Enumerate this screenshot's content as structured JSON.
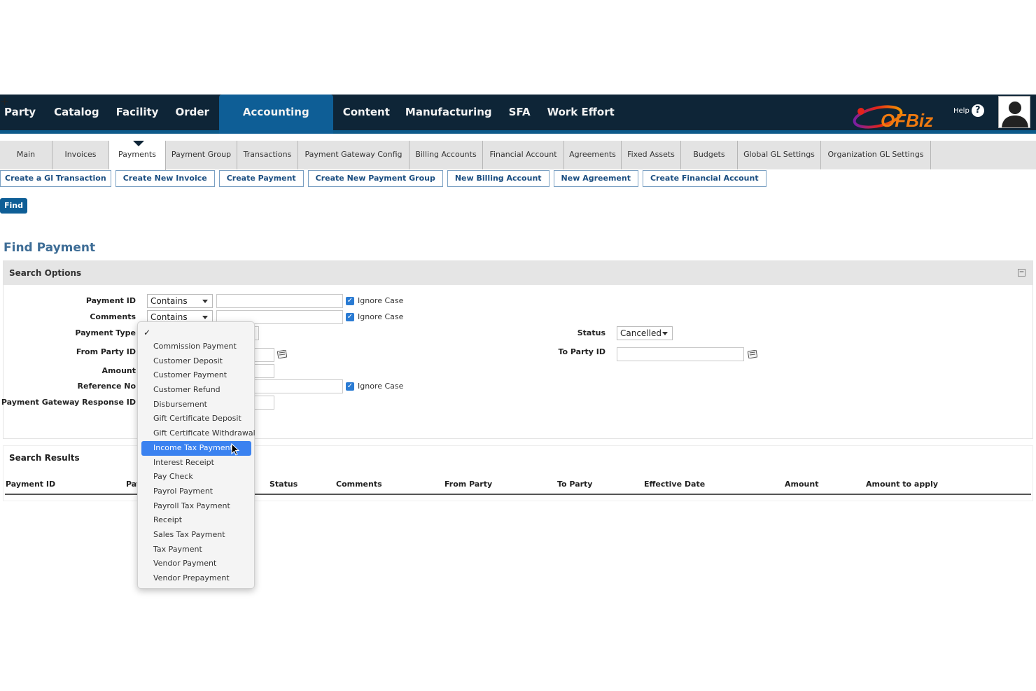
{
  "topnav": {
    "items": [
      "Party",
      "Catalog",
      "Facility",
      "Order",
      "Accounting",
      "Content",
      "Manufacturing",
      "SFA",
      "Work Effort"
    ],
    "active": "Accounting",
    "plus": "+",
    "logo_text": "OFBiz",
    "help_label": "Help",
    "help_glyph": "?"
  },
  "subtabs": {
    "items": [
      "Main",
      "Invoices",
      "Payments",
      "Payment Group",
      "Transactions",
      "Payment Gateway Config",
      "Billing Accounts",
      "Financial Account",
      "Agreements",
      "Fixed Assets",
      "Budgets",
      "Global GL Settings",
      "Organization GL Settings"
    ],
    "active": "Payments"
  },
  "actions": [
    "Create a Gl Transaction",
    "Create New Invoice",
    "Create Payment",
    "Create New Payment Group",
    "New Billing Account",
    "New Agreement",
    "Create Financial Account"
  ],
  "find_button": "Find",
  "page_title": "Find Payment",
  "search_options": {
    "title": "Search Options",
    "collapse_glyph": "−",
    "labels": {
      "payment_id": "Payment ID",
      "comments": "Comments",
      "payment_type": "Payment Type",
      "from_party": "From Party ID",
      "amount": "Amount",
      "reference_no": "Reference No",
      "gateway_response": "Payment Gateway Response ID",
      "status": "Status",
      "to_party": "To Party ID"
    },
    "payment_id_op": "Contains",
    "comments_op": "Contains",
    "ignore_case": "Ignore Case",
    "status_value": "Cancelled"
  },
  "search_results": {
    "title": "Search Results",
    "columns": [
      "Payment ID",
      "Pay",
      "Status",
      "Comments",
      "From Party",
      "To Party",
      "Effective Date",
      "Amount",
      "Amount to apply"
    ]
  },
  "payment_type_dropdown": {
    "check": "✓",
    "options": [
      "Commission Payment",
      "Customer Deposit",
      "Customer Payment",
      "Customer Refund",
      "Disbursement",
      "Gift Certificate Deposit",
      "Gift Certificate Withdrawal",
      "Income Tax Payment",
      "Interest Receipt",
      "Pay Check",
      "Payrol Payment",
      "Payroll Tax Payment",
      "Receipt",
      "Sales Tax Payment",
      "Tax Payment",
      "Vendor Payment",
      "Vendor Prepayment"
    ],
    "highlighted": "Income Tax Payment"
  },
  "colors": {
    "nav_bg": "#0e2537",
    "nav_active": "#0e5e96",
    "title": "#3e6d96",
    "highlight": "#3b82f0"
  }
}
